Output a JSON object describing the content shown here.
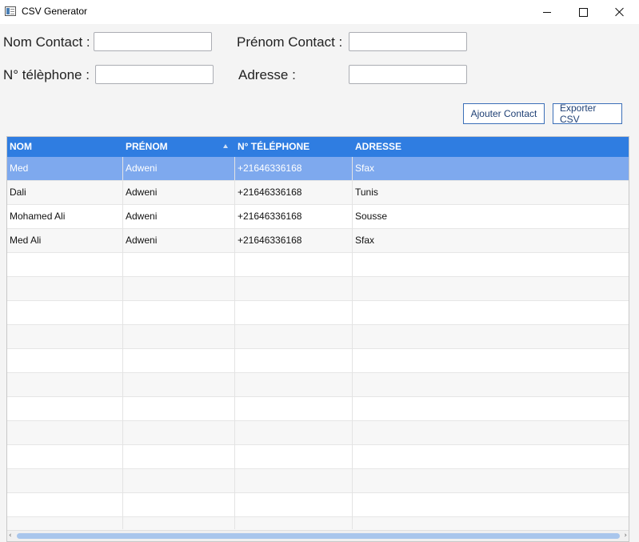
{
  "window": {
    "title": "CSV Generator"
  },
  "form": {
    "nom_label": "Nom Contact :",
    "prenom_label": "Prénom Contact :",
    "tel_label": "N° télèphone :",
    "adresse_label": "Adresse :",
    "nom_value": "",
    "prenom_value": "",
    "tel_value": "",
    "adresse_value": ""
  },
  "buttons": {
    "ajouter": "Ajouter Contact",
    "exporter": "Exporter CSV"
  },
  "table": {
    "columns": [
      "NOM",
      "PRÉNOM",
      "N° TÉLÉPHONE",
      "ADRESSE"
    ],
    "sort": {
      "column": "PRÉNOM",
      "direction": "ascending"
    },
    "rows": [
      {
        "nom": "Med",
        "prenom": "Adweni",
        "tel": "+21646336168",
        "adresse": "Sfax",
        "selected": true
      },
      {
        "nom": "Dali",
        "prenom": "Adweni",
        "tel": "+21646336168",
        "adresse": "Tunis"
      },
      {
        "nom": "Mohamed Ali",
        "prenom": "Adweni",
        "tel": "+21646336168",
        "adresse": "Sousse"
      },
      {
        "nom": "Med Ali",
        "prenom": "Adweni",
        "tel": "+21646336168",
        "adresse": "Sfax"
      }
    ]
  },
  "colors": {
    "header": "#2f7de1",
    "selected_row": "#7ea9ee",
    "button_border": "#3b6fb8"
  }
}
